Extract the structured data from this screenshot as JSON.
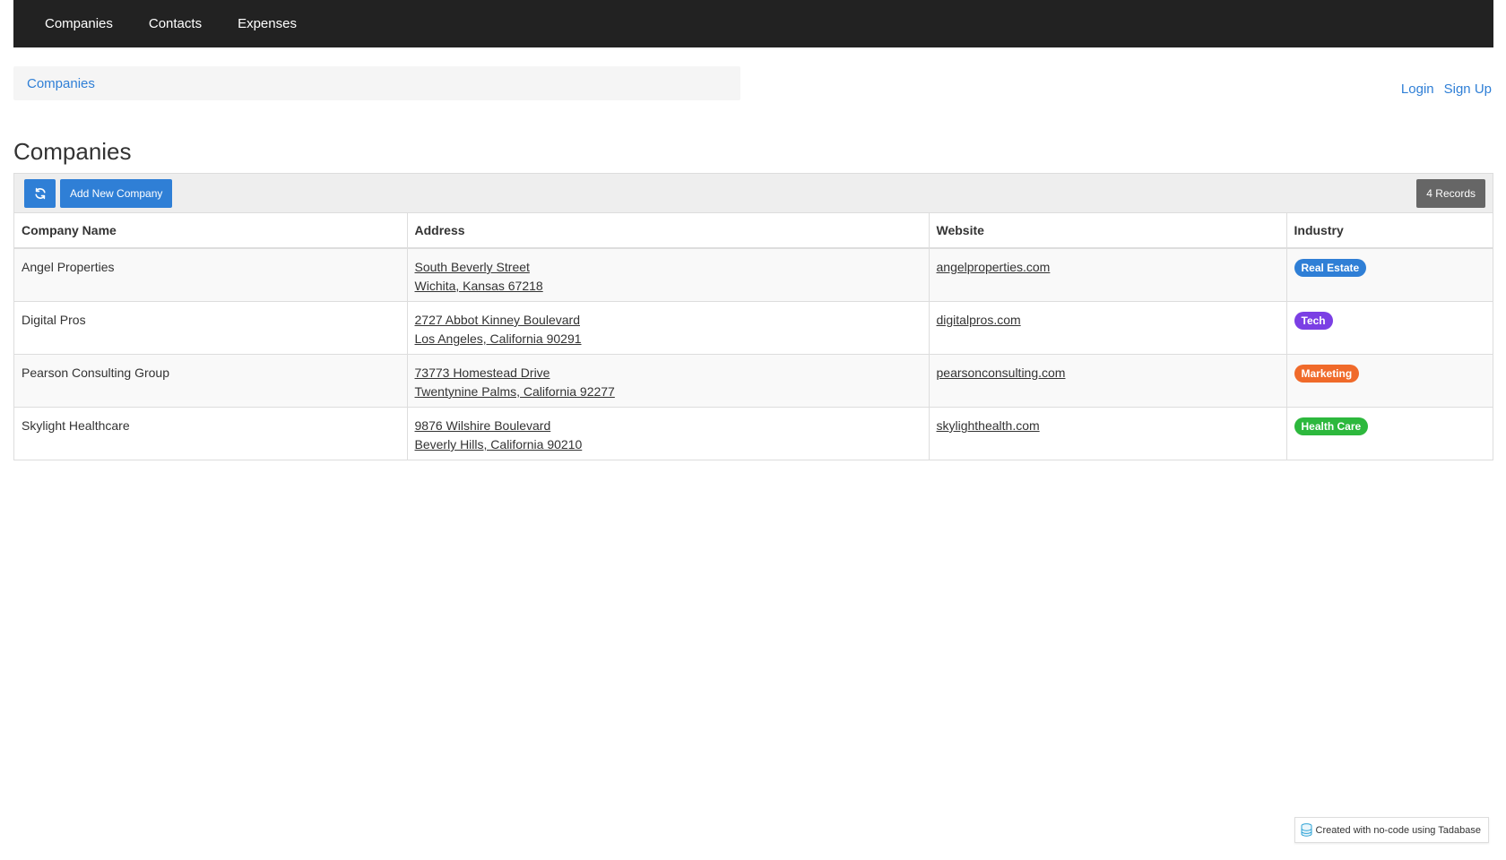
{
  "nav": {
    "items": [
      {
        "label": "Companies"
      },
      {
        "label": "Contacts"
      },
      {
        "label": "Expenses"
      }
    ]
  },
  "breadcrumb": {
    "label": "Companies"
  },
  "auth": {
    "login": "Login",
    "signup": "Sign Up"
  },
  "page": {
    "title": "Companies"
  },
  "toolbar": {
    "refresh_icon": "refresh-icon",
    "add_label": "Add New Company",
    "records_label": "4 Records"
  },
  "table": {
    "columns": [
      "Company Name",
      "Address",
      "Website",
      "Industry"
    ],
    "rows": [
      {
        "name": "Angel Properties",
        "address_line1": "South Beverly Street",
        "address_line2": "Wichita, Kansas 67218",
        "website": "angelproperties.com",
        "industry": "Real Estate",
        "industry_color": "#2f7fd6"
      },
      {
        "name": "Digital Pros",
        "address_line1": "2727 Abbot Kinney Boulevard",
        "address_line2": "Los Angeles, California 90291",
        "website": "digitalpros.com",
        "industry": "Tech",
        "industry_color": "#7b3fe4"
      },
      {
        "name": "Pearson Consulting Group",
        "address_line1": "73773 Homestead Drive",
        "address_line2": "Twentynine Palms, California 92277",
        "website": "pearsonconsulting.com",
        "industry": "Marketing",
        "industry_color": "#f06a2a"
      },
      {
        "name": "Skylight Healthcare",
        "address_line1": "9876 Wilshire Boulevard",
        "address_line2": "Beverly Hills, California 90210",
        "website": "skylighthealth.com",
        "industry": "Health Care",
        "industry_color": "#2db83d"
      }
    ]
  },
  "footer": {
    "badge_icon": "database-icon",
    "badge_label": "Created with no-code using Tadabase"
  },
  "colors": {
    "accent": "#2f7fd6",
    "navbar": "#222222"
  }
}
